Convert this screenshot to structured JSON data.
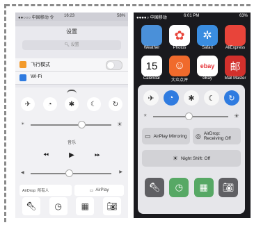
{
  "left": {
    "status": {
      "carrier": "●●○○○ 中国移动 令",
      "time": "16:23",
      "battery": "58%"
    },
    "nav_title": "设置",
    "search_placeholder": "设置",
    "rows": [
      {
        "label": "飞行模式",
        "color": "#f39a2b"
      },
      {
        "label": "Wi-Fi",
        "color": "#2f7be0"
      }
    ],
    "cc": {
      "music_label": "音乐",
      "airdrop_label": "AirDrop: 所有人",
      "airplay_label": "AirPlay"
    }
  },
  "right": {
    "status": {
      "carrier": "●●●●○ 中国移动",
      "time": "6:01 PM",
      "battery": "63%"
    },
    "apps_row1": [
      {
        "label": "Weather",
        "color": "#4a90d9"
      },
      {
        "label": "Photos",
        "color": "#ffffff"
      },
      {
        "label": "Safari",
        "color": "#3a8de0"
      },
      {
        "label": "AliExpress",
        "color": "#e8443a"
      }
    ],
    "apps_row2": [
      {
        "label": "Calendar",
        "day": "15",
        "color": "#ffffff"
      },
      {
        "label": "大众点评",
        "color": "#f06a2c"
      },
      {
        "label": "eBay",
        "color": "#ffffff"
      },
      {
        "label": "Mail Master",
        "color": "#d2302c"
      }
    ],
    "cc": {
      "airplay_label": "AirPlay Mirroring",
      "airdrop_label": "AirDrop: Receiving Off",
      "night_shift_label": "Night Shift: Off"
    }
  }
}
